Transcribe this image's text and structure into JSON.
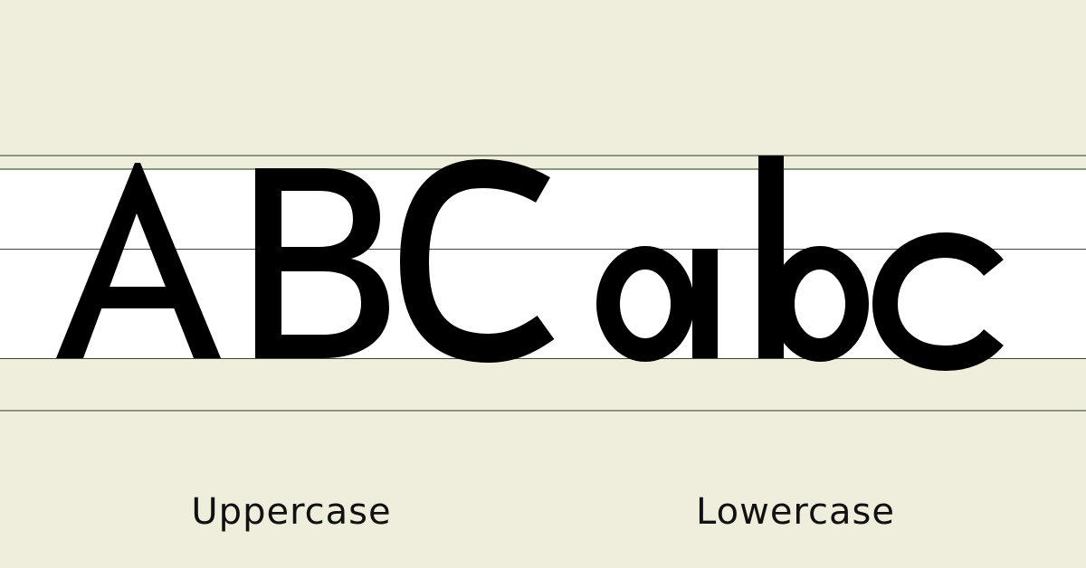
{
  "uppercase": {
    "letters": "ABC",
    "label": "Uppercase"
  },
  "lowercase": {
    "letters": "abc",
    "label": "Lowercase"
  },
  "colors": {
    "background": "#efeddb",
    "band": "#ffffff",
    "guide": "#8b9680",
    "guide_dark": "#3c4a38",
    "ink": "#000000"
  }
}
